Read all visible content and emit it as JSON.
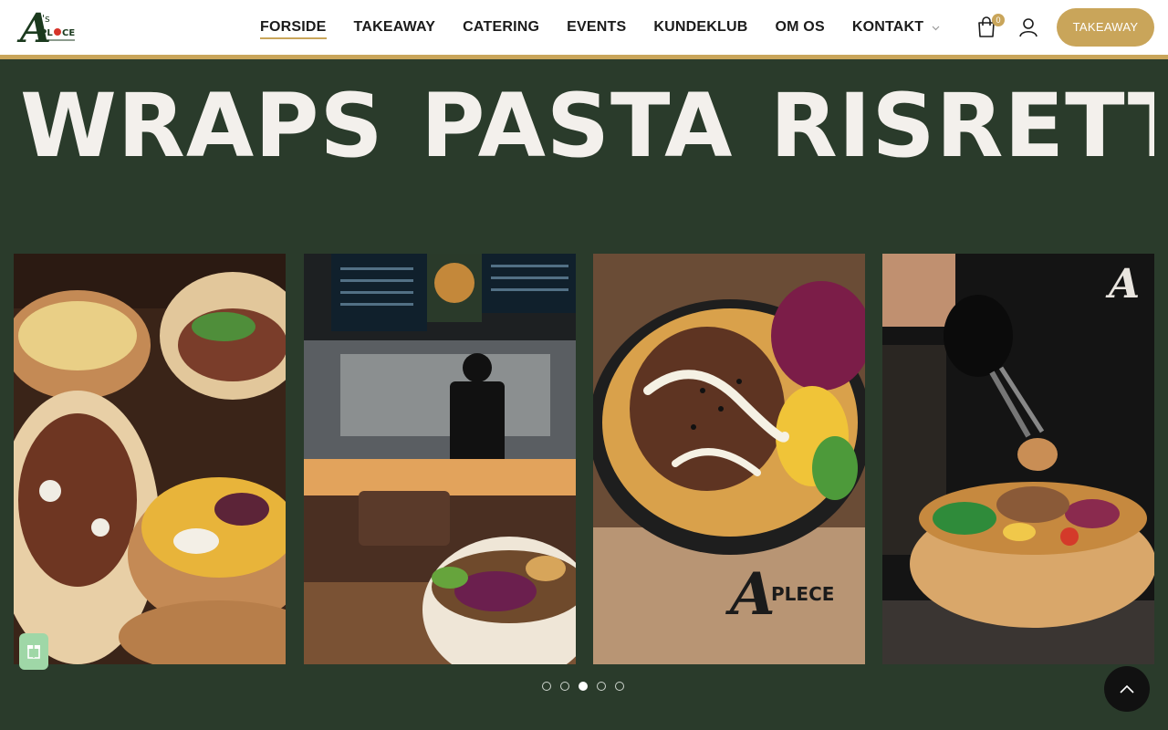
{
  "brand": {
    "logo_text": "A'S PLACE",
    "accent": "#c9a55a",
    "background": "#2a3b2b"
  },
  "nav": {
    "items": [
      {
        "label": "FORSIDE",
        "active": true
      },
      {
        "label": "TAKEAWAY"
      },
      {
        "label": "CATERING"
      },
      {
        "label": "EVENTS"
      },
      {
        "label": "KUNDEKLUB"
      },
      {
        "label": "OM OS"
      },
      {
        "label": "KONTAKT",
        "dropdown": true
      }
    ]
  },
  "header": {
    "cart_count": "0",
    "cta_label": "TAKEAWAY",
    "icons": [
      "shopping-bag-icon",
      "user-icon",
      "chevron-down-icon"
    ]
  },
  "marquee": {
    "words": [
      "WRAPS",
      "PASTA",
      "RISRETTER"
    ]
  },
  "carousel": {
    "slides": [
      {
        "name": "wraps-and-bowls-photo"
      },
      {
        "name": "restaurant-kitchen-photo"
      },
      {
        "name": "loaded-fries-bowl-photo"
      },
      {
        "name": "chef-serving-bowl-photo"
      }
    ],
    "page_count": 5,
    "active_index": 2
  },
  "widgets": {
    "gift_icon": "gift-icon",
    "scroll_top_icon": "chevron-up-icon"
  }
}
